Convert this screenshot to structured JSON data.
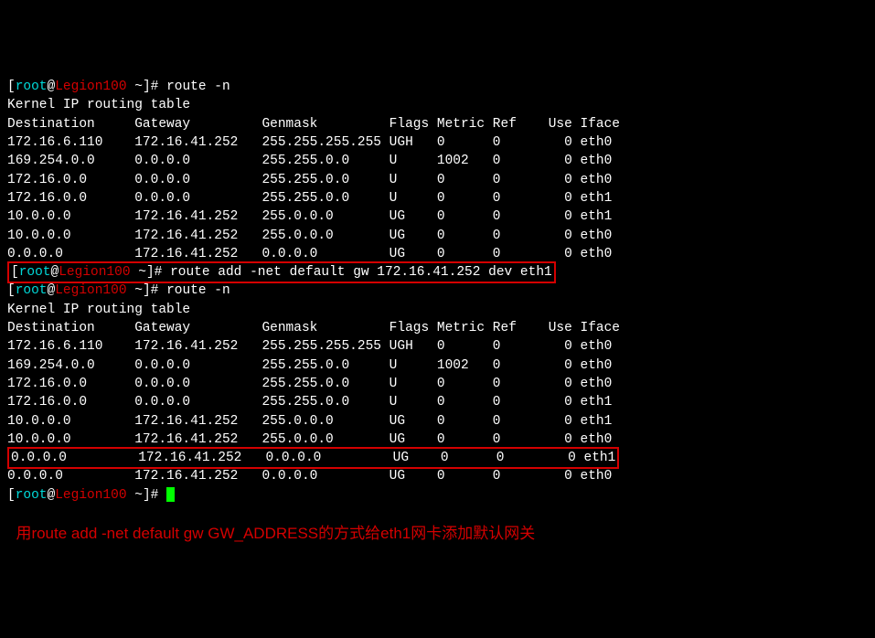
{
  "prompt": {
    "open": "[",
    "user": "root",
    "at": "@",
    "host": "Legion100",
    "dir": " ~",
    "close": "]# "
  },
  "cmds": {
    "route_n_1": "route -n",
    "route_add": "route add -net default gw 172.16.41.252 dev eth1",
    "route_n_2": "route -n"
  },
  "heading": "Kernel IP routing table",
  "hdr": {
    "dest": "Destination",
    "gw": "Gateway",
    "mask": "Genmask",
    "flags": "Flags",
    "metric": "Metric",
    "ref": "Ref",
    "use": "Use",
    "iface": "Iface"
  },
  "table1": [
    {
      "dest": "172.16.6.110",
      "gw": "172.16.41.252",
      "mask": "255.255.255.255",
      "flags": "UGH",
      "metric": "0",
      "ref": "0",
      "use": "0",
      "iface": "eth0"
    },
    {
      "dest": "169.254.0.0",
      "gw": "0.0.0.0",
      "mask": "255.255.0.0",
      "flags": "U",
      "metric": "1002",
      "ref": "0",
      "use": "0",
      "iface": "eth0"
    },
    {
      "dest": "172.16.0.0",
      "gw": "0.0.0.0",
      "mask": "255.255.0.0",
      "flags": "U",
      "metric": "0",
      "ref": "0",
      "use": "0",
      "iface": "eth0"
    },
    {
      "dest": "172.16.0.0",
      "gw": "0.0.0.0",
      "mask": "255.255.0.0",
      "flags": "U",
      "metric": "0",
      "ref": "0",
      "use": "0",
      "iface": "eth1"
    },
    {
      "dest": "10.0.0.0",
      "gw": "172.16.41.252",
      "mask": "255.0.0.0",
      "flags": "UG",
      "metric": "0",
      "ref": "0",
      "use": "0",
      "iface": "eth1"
    },
    {
      "dest": "10.0.0.0",
      "gw": "172.16.41.252",
      "mask": "255.0.0.0",
      "flags": "UG",
      "metric": "0",
      "ref": "0",
      "use": "0",
      "iface": "eth0"
    },
    {
      "dest": "0.0.0.0",
      "gw": "172.16.41.252",
      "mask": "0.0.0.0",
      "flags": "UG",
      "metric": "0",
      "ref": "0",
      "use": "0",
      "iface": "eth0"
    }
  ],
  "table2": [
    {
      "dest": "172.16.6.110",
      "gw": "172.16.41.252",
      "mask": "255.255.255.255",
      "flags": "UGH",
      "metric": "0",
      "ref": "0",
      "use": "0",
      "iface": "eth0"
    },
    {
      "dest": "169.254.0.0",
      "gw": "0.0.0.0",
      "mask": "255.255.0.0",
      "flags": "U",
      "metric": "1002",
      "ref": "0",
      "use": "0",
      "iface": "eth0"
    },
    {
      "dest": "172.16.0.0",
      "gw": "0.0.0.0",
      "mask": "255.255.0.0",
      "flags": "U",
      "metric": "0",
      "ref": "0",
      "use": "0",
      "iface": "eth0"
    },
    {
      "dest": "172.16.0.0",
      "gw": "0.0.0.0",
      "mask": "255.255.0.0",
      "flags": "U",
      "metric": "0",
      "ref": "0",
      "use": "0",
      "iface": "eth1"
    },
    {
      "dest": "10.0.0.0",
      "gw": "172.16.41.252",
      "mask": "255.0.0.0",
      "flags": "UG",
      "metric": "0",
      "ref": "0",
      "use": "0",
      "iface": "eth1"
    },
    {
      "dest": "10.0.0.0",
      "gw": "172.16.41.252",
      "mask": "255.0.0.0",
      "flags": "UG",
      "metric": "0",
      "ref": "0",
      "use": "0",
      "iface": "eth0"
    },
    {
      "dest": "0.0.0.0",
      "gw": "172.16.41.252",
      "mask": "0.0.0.0",
      "flags": "UG",
      "metric": "0",
      "ref": "0",
      "use": "0",
      "iface": "eth1"
    },
    {
      "dest": "0.0.0.0",
      "gw": "172.16.41.252",
      "mask": "0.0.0.0",
      "flags": "UG",
      "metric": "0",
      "ref": "0",
      "use": "0",
      "iface": "eth0"
    }
  ],
  "annotation": "用route add -net default gw GW_ADDRESS的方式给eth1网卡添加默认网关"
}
